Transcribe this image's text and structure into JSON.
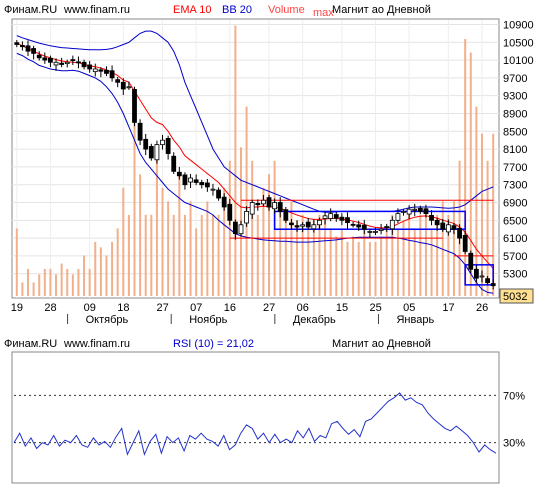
{
  "header": {
    "source": "Финам.RU",
    "site": "www.finam.ru",
    "ema_label": "EMA 10",
    "bb_label": "BB 20",
    "volume_label": "Volume",
    "max_label": "max",
    "title": "Магнит ао Дневной"
  },
  "rsi_header": {
    "source": "Финам.RU",
    "site": "www.finam.ru",
    "rsi_label": "RSI (10) = 21,02",
    "title": "Магнит ао Дневной"
  },
  "colors": {
    "up": "#ffffff",
    "down": "#000000",
    "ema": "#ff0000",
    "bollinger": "#0000cc",
    "volume": "#f2b08a",
    "support_red": "#ff0000",
    "box_blue": "#0000ff",
    "rsi_line": "#2233cc",
    "last_price_bg": "#ffe090"
  },
  "chart_data": [
    {
      "type": "candlestick",
      "title": "Магнит ао Дневной",
      "ylim": [
        4800,
        11000
      ],
      "yticks": [
        10900,
        10500,
        10100,
        9700,
        9300,
        8900,
        8500,
        8100,
        7700,
        7300,
        6900,
        6500,
        6100,
        5700,
        5300
      ],
      "x_day_labels": [
        "19",
        "28",
        "09",
        "18",
        "27",
        "07",
        "16",
        "27",
        "06",
        "15",
        "25",
        "05",
        "17",
        "26"
      ],
      "month_labels": [
        "Октябрь",
        "Ноябрь",
        "Декабрь",
        "Январь"
      ],
      "last_price": "5032",
      "closes": [
        10450,
        10400,
        10300,
        10250,
        10150,
        10100,
        10050,
        10050,
        10000,
        10050,
        10100,
        10050,
        9950,
        9900,
        9900,
        9850,
        9800,
        9700,
        9600,
        9450,
        9500,
        8700,
        8300,
        8100,
        7900,
        8200,
        8300,
        8000,
        7600,
        7500,
        7300,
        7450,
        7350,
        7300,
        7250,
        7200,
        7000,
        6800,
        6500,
        6200,
        6400,
        6700,
        6900,
        6850,
        6950,
        6800,
        6900,
        6700,
        6500,
        6400,
        6350,
        6400,
        6350,
        6400,
        6500,
        6600,
        6650,
        6550,
        6500,
        6450,
        6400,
        6350,
        6300,
        6250,
        6250,
        6300,
        6350,
        6500,
        6650,
        6700,
        6750,
        6750,
        6700,
        6650,
        6500,
        6400,
        6300,
        6400,
        6300,
        6100,
        5800,
        5400,
        5200,
        5250,
        5100,
        5032
      ],
      "ema10": [
        10480,
        10420,
        10360,
        10300,
        10240,
        10190,
        10150,
        10110,
        10080,
        10060,
        10050,
        10040,
        10000,
        9970,
        9950,
        9920,
        9880,
        9820,
        9750,
        9650,
        9600,
        9400,
        9200,
        9000,
        8800,
        8700,
        8650,
        8500,
        8300,
        8150,
        7950,
        7850,
        7750,
        7650,
        7550,
        7450,
        7350,
        7200,
        7050,
        6900,
        6800,
        6780,
        6800,
        6800,
        6820,
        6800,
        6800,
        6770,
        6720,
        6670,
        6620,
        6580,
        6540,
        6520,
        6520,
        6530,
        6540,
        6540,
        6530,
        6510,
        6480,
        6450,
        6410,
        6370,
        6340,
        6330,
        6330,
        6360,
        6420,
        6480,
        6530,
        6570,
        6590,
        6600,
        6580,
        6550,
        6500,
        6470,
        6430,
        6350,
        6230,
        6050,
        5850,
        5700,
        5560,
        5420
      ],
      "bb_upper": [
        10650,
        10600,
        10560,
        10520,
        10480,
        10450,
        10420,
        10400,
        10380,
        10370,
        10360,
        10350,
        10340,
        10330,
        10330,
        10330,
        10340,
        10360,
        10400,
        10450,
        10500,
        10600,
        10700,
        10750,
        10750,
        10700,
        10600,
        10500,
        10300,
        10000,
        9600,
        9300,
        9000,
        8700,
        8400,
        8100,
        7900,
        7700,
        7600,
        7500,
        7400,
        7350,
        7300,
        7250,
        7200,
        7150,
        7100,
        7050,
        7000,
        6950,
        6900,
        6850,
        6800,
        6750,
        6700,
        6680,
        6680,
        6690,
        6700,
        6700,
        6700,
        6700,
        6700,
        6700,
        6700,
        6700,
        6700,
        6700,
        6720,
        6750,
        6780,
        6800,
        6800,
        6800,
        6800,
        6790,
        6780,
        6770,
        6780,
        6800,
        6850,
        6950,
        7050,
        7150,
        7200,
        7250
      ],
      "bb_lower": [
        10250,
        10200,
        10120,
        10060,
        9980,
        9940,
        9900,
        9880,
        9860,
        9860,
        9870,
        9850,
        9800,
        9750,
        9700,
        9620,
        9500,
        9350,
        9150,
        8900,
        8600,
        8300,
        8000,
        7800,
        7650,
        7500,
        7350,
        7200,
        7100,
        7000,
        6900,
        6850,
        6800,
        6750,
        6700,
        6620,
        6500,
        6400,
        6300,
        6200,
        6150,
        6120,
        6100,
        6080,
        6060,
        6050,
        6040,
        6030,
        6030,
        6020,
        6010,
        6010,
        6010,
        6020,
        6030,
        6040,
        6050,
        6060,
        6080,
        6100,
        6110,
        6120,
        6120,
        6120,
        6120,
        6120,
        6120,
        6120,
        6100,
        6080,
        6050,
        6030,
        6000,
        5980,
        5950,
        5900,
        5850,
        5800,
        5750,
        5650,
        5500,
        5300,
        5100,
        4950,
        4880,
        4860
      ],
      "volume_relative": [
        0.25,
        0.05,
        0.1,
        0.05,
        0.08,
        0.1,
        0.1,
        0.08,
        0.12,
        0.1,
        0.08,
        0.1,
        0.15,
        0.1,
        0.2,
        0.18,
        0.15,
        0.2,
        0.25,
        0.4,
        0.3,
        0.7,
        0.45,
        0.3,
        0.3,
        0.55,
        0.4,
        0.35,
        0.3,
        0.45,
        0.3,
        0.35,
        0.25,
        0.3,
        0.35,
        0.3,
        0.3,
        0.4,
        0.5,
        1.0,
        0.55,
        0.7,
        0.5,
        0.3,
        0.4,
        0.45,
        0.5,
        0.35,
        0.3,
        0.35,
        0.28,
        0.3,
        0.25,
        0.28,
        0.3,
        0.3,
        0.25,
        0.22,
        0.25,
        0.2,
        0.22,
        0.2,
        0.25,
        0.2,
        0.2,
        0.22,
        0.25,
        0.3,
        0.25,
        0.28,
        0.3,
        0.25,
        0.3,
        0.3,
        0.25,
        0.3,
        0.35,
        0.3,
        0.35,
        0.5,
        0.95,
        0.9,
        0.7,
        0.6,
        0.5,
        0.6
      ]
    },
    {
      "type": "line",
      "title": "RSI (10) = 21,02",
      "ylim": [
        0,
        100
      ],
      "levels": [
        70,
        30
      ],
      "level_labels": [
        "70%",
        "30%"
      ],
      "values": [
        30,
        38,
        27,
        34,
        25,
        30,
        28,
        36,
        27,
        32,
        30,
        36,
        28,
        26,
        34,
        28,
        31,
        26,
        35,
        42,
        20,
        30,
        40,
        20,
        31,
        37,
        21,
        35,
        30,
        34,
        23,
        36,
        33,
        38,
        33,
        31,
        27,
        36,
        24,
        28,
        38,
        45,
        42,
        33,
        38,
        30,
        37,
        30,
        33,
        30,
        40,
        34,
        42,
        31,
        36,
        34,
        46,
        48,
        42,
        37,
        41,
        35,
        48,
        50,
        55,
        60,
        65,
        68,
        72,
        66,
        68,
        64,
        62,
        55,
        50,
        46,
        42,
        40,
        44,
        40,
        36,
        30,
        22,
        28,
        24,
        21
      ]
    }
  ]
}
